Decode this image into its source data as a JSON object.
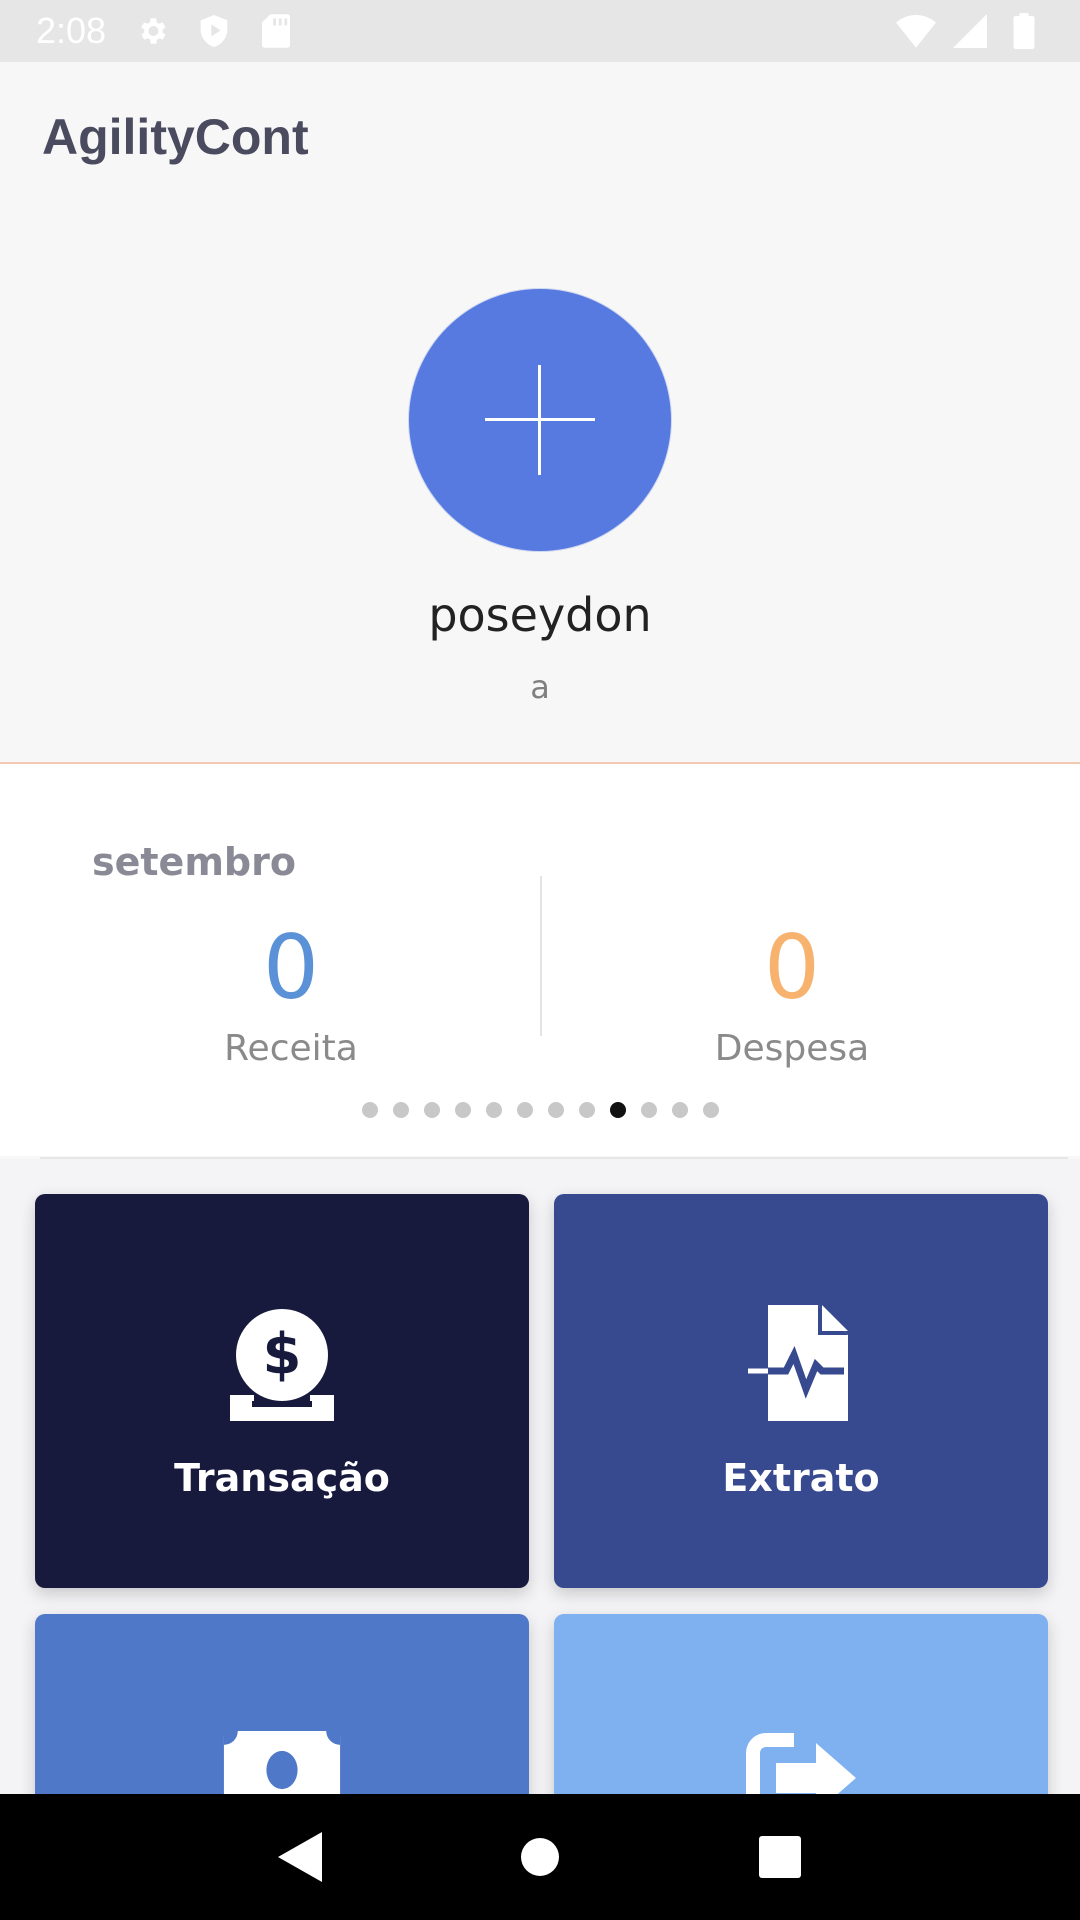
{
  "status_bar": {
    "time": "2:08",
    "left_icons": [
      "gear-icon",
      "shield-icon",
      "sd-card-icon"
    ],
    "right_icons": [
      "wifi-icon",
      "signal-icon",
      "battery-icon"
    ]
  },
  "app_bar": {
    "title": "AgilityCont"
  },
  "profile": {
    "avatar_icon": "plus-icon",
    "username": "poseydon",
    "subtitle": "a",
    "accent_color": "#577ae0"
  },
  "summary": {
    "month": "setembro",
    "income": {
      "value": "0",
      "label": "Receita",
      "color": "#5b91d6"
    },
    "expense": {
      "value": "0",
      "label": "Despesa",
      "color": "#f7b26e"
    },
    "pager": {
      "total": 12,
      "active_index": 8
    }
  },
  "tiles": [
    {
      "label": "Transação",
      "icon": "money-deposit-icon",
      "color": "#17193d"
    },
    {
      "label": "Extrato",
      "icon": "file-report-icon",
      "color": "#374a8f"
    },
    {
      "label": "",
      "icon": "banknote-icon",
      "color": "#5078c9"
    },
    {
      "label": "",
      "icon": "share-arrow-icon",
      "color": "#7fb0f0"
    }
  ],
  "nav_bar": {
    "buttons": [
      "back-icon",
      "home-icon",
      "recents-icon"
    ]
  }
}
